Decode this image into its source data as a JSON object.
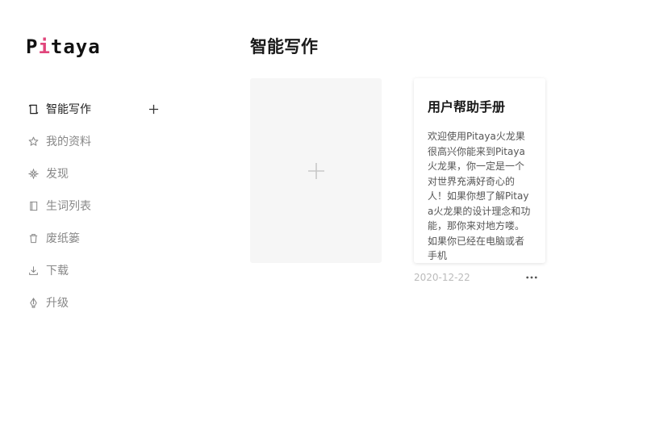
{
  "app": {
    "logo_prefix": "P",
    "logo_accent": "i",
    "logo_suffix": "taya",
    "accent_color": "#e0457b"
  },
  "sidebar": {
    "items": [
      {
        "label": "智能写作",
        "icon": "document-icon",
        "active": true
      },
      {
        "label": "我的资料",
        "icon": "star-icon",
        "active": false
      },
      {
        "label": "发现",
        "icon": "compass-icon",
        "active": false
      },
      {
        "label": "生词列表",
        "icon": "book-icon",
        "active": false
      },
      {
        "label": "废纸篓",
        "icon": "trash-icon",
        "active": false
      },
      {
        "label": "下载",
        "icon": "download-icon",
        "active": false
      },
      {
        "label": "升级",
        "icon": "pen-nib-icon",
        "active": false
      }
    ],
    "add_icon": "plus-icon"
  },
  "main": {
    "title": "智能写作",
    "new_card_icon": "plus-icon",
    "documents": [
      {
        "title": "用户帮助手册",
        "excerpt": "欢迎使用Pitaya火龙果很高兴你能来到Pitaya火龙果，你一定是一个对世界充满好奇心的人！如果你想了解Pitaya火龙果的设计理念和功能，那你来对地方喽。 如果你已经在电脑或者手机",
        "date": "2020-12-22",
        "more_icon": "more-horizontal-icon"
      }
    ]
  }
}
